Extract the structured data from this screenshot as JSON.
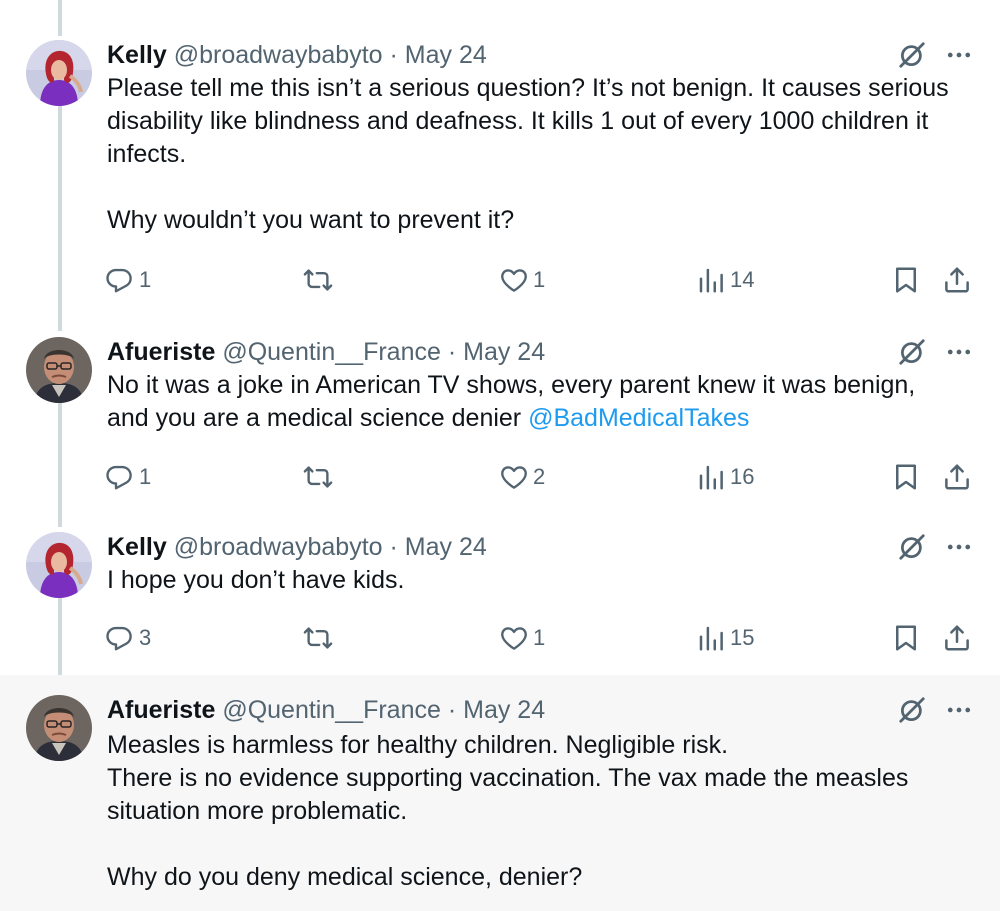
{
  "tweets": [
    {
      "name": "Kelly",
      "handle": "@broadwaybabyto",
      "sep": "·",
      "date": "May 24",
      "avatar": "kelly-avatar",
      "lines": [
        "Please tell me this isn’t a serious question? It’s not benign. It causes serious",
        "disability like blindness and deafness. It kills 1 out of every 1000 children it",
        "infects.",
        "",
        "Why wouldn’t you want to prevent it?"
      ],
      "replies": "1",
      "retweets": "",
      "likes": "1",
      "views": "14"
    },
    {
      "name": "Afueriste",
      "handle": "@Quentin__France",
      "sep": "·",
      "date": "May 24",
      "avatar": "afueriste-avatar",
      "line1": "No it was a joke in American TV shows, every parent knew it was benign,",
      "line2_text": "and you are a medical science denier ",
      "line2_mention": "@BadMedicalTakes",
      "replies": "1",
      "retweets": "",
      "likes": "2",
      "views": "16"
    },
    {
      "name": "Kelly",
      "handle": "@broadwaybabyto",
      "sep": "·",
      "date": "May 24",
      "avatar": "kelly-avatar",
      "lines": [
        "I hope you don’t have kids."
      ],
      "replies": "3",
      "retweets": "",
      "likes": "1",
      "views": "15"
    },
    {
      "name": "Afueriste",
      "handle": "@Quentin__France",
      "sep": "·",
      "date": "May 24",
      "avatar": "afueriste-avatar",
      "lines": [
        "Measles is harmless for healthy children. Negligible risk.",
        "There is no evidence supporting vaccination. The vax made the measles",
        "situation more problematic.",
        "",
        "Why do you deny medical science, denier?"
      ]
    }
  ],
  "colors": {
    "text": "#0f1419",
    "secondary": "#536471",
    "mention": "#1d9bf0",
    "thread_line": "#cfd9de",
    "highlight_bg": "#f7f7f7"
  },
  "icons": [
    "reply-icon",
    "retweet-icon",
    "like-icon",
    "views-icon",
    "bookmark-icon",
    "share-icon",
    "grok-icon",
    "more-icon"
  ]
}
